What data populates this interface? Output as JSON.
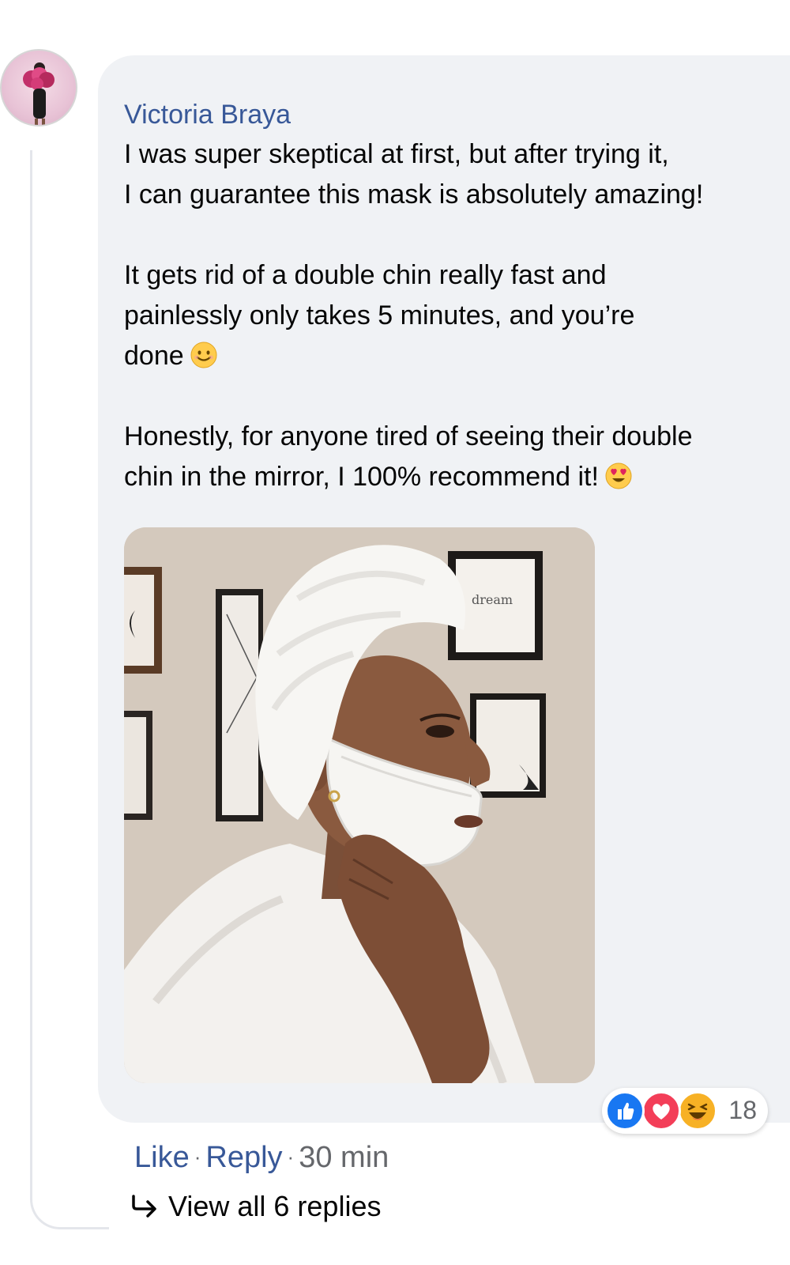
{
  "comment": {
    "author": "Victoria Braya",
    "paragraphs": [
      {
        "lines": [
          "I was super skeptical at first, but after trying it,",
          "I can guarantee this mask is absolutely amazing!"
        ]
      },
      {
        "lines": [
          "It gets rid of a double chin really fast and",
          "painlessly only takes 5 minutes, and you’re",
          "done"
        ],
        "emoji": "smiling-face-emoji"
      },
      {
        "lines": [
          "Honestly, for anyone tired of seeing their double",
          "chin in the mirror, I 100% recommend it!"
        ],
        "emoji": "heart-eyes-emoji"
      }
    ],
    "photo": {
      "frame_text": "dream"
    },
    "reactions": {
      "icons": [
        "like-icon",
        "love-icon",
        "haha-icon"
      ],
      "count": "18"
    },
    "actions": {
      "like_label": "Like",
      "reply_label": "Reply",
      "separator": "·",
      "timestamp": "30 min"
    },
    "view_replies_label": "View all 6 replies"
  },
  "colors": {
    "link_blue": "#385898",
    "bubble_bg": "#f0f2f5",
    "like_blue": "#1877f2",
    "love_red": "#f33e58",
    "haha_yellow": "#f7b125"
  }
}
